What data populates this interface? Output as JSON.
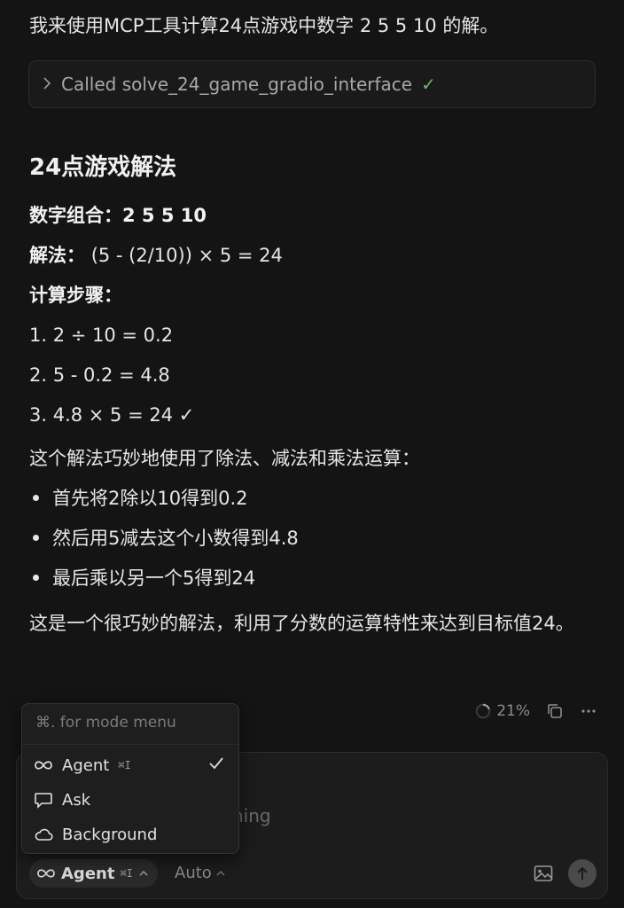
{
  "intro": "我来使用MCP工具计算24点游戏中数字 2 5 5 10 的解。",
  "tool_call": {
    "label": "Called solve_24_game_gradio_interface",
    "status_mark": "✓"
  },
  "heading": "24点游戏解法",
  "numbers_label": "数字组合：",
  "numbers_value": "2 5 5 10",
  "solution_label": "解法：",
  "solution_value": "(5 - (2/10)) × 5 = 24",
  "steps_label": "计算步骤：",
  "steps": [
    "1. 2 ÷ 10 = 0.2",
    "2. 5 - 0.2 = 4.8",
    "3. 4.8 × 5 = 24 ✓"
  ],
  "explanation": "这个解法巧妙地使用了除法、减法和乘法运算：",
  "bullets": [
    "首先将2除以10得到0.2",
    "然后用5减去这个小数得到4.8",
    "最后乘以另一个5得到24"
  ],
  "closing": "这是一个很巧妙的解法，利用了分数的运算特性来达到目标值24。",
  "status": {
    "context_percent": "21%"
  },
  "mode_menu": {
    "hint": "⌘. for mode menu",
    "items": [
      {
        "label": "Agent",
        "shortcut": "⌘I",
        "icon": "infinity-icon",
        "selected": true
      },
      {
        "label": "Ask",
        "icon": "chat-bubble-icon"
      },
      {
        "label": "Background",
        "icon": "cloud-icon"
      }
    ]
  },
  "composer": {
    "placeholder_visible": "hing",
    "mode_label": "Agent",
    "mode_shortcut": "⌘I",
    "model_label": "Auto"
  },
  "colors": {
    "background": "#141414",
    "accent_check": "#6fb46f"
  }
}
